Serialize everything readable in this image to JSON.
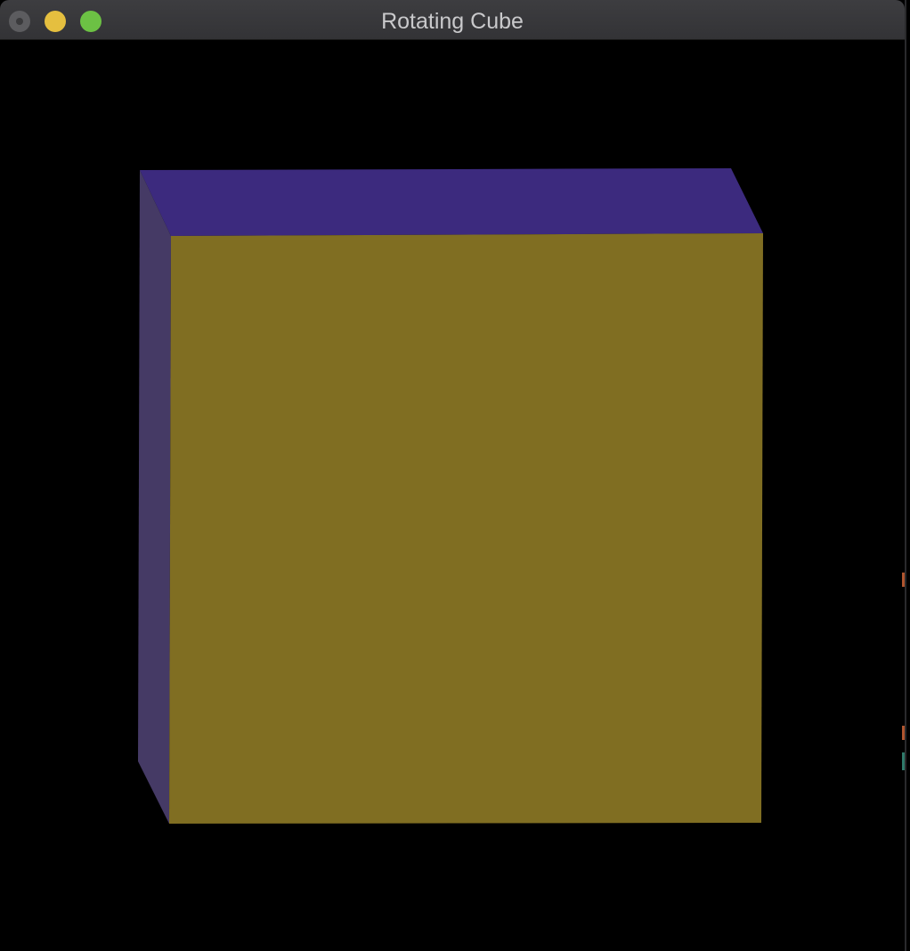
{
  "window": {
    "title": "Rotating Cube"
  },
  "titlebar_buttons": {
    "close": "close-button",
    "minimize": "minimize-button",
    "zoom": "zoom-button"
  },
  "scene": {
    "background_color": "#000000",
    "faces": {
      "front": "#806e22",
      "top": "#3c2a7e",
      "left": "#453a65"
    }
  }
}
